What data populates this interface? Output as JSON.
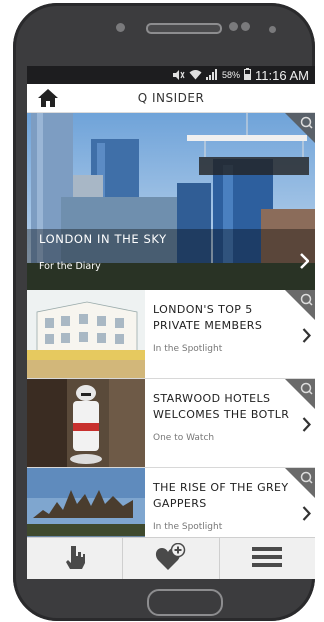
{
  "status_bar": {
    "battery": "58%",
    "time": "11:16 AM"
  },
  "header": {
    "title": "Q INSIDER"
  },
  "hero": {
    "title": "LONDON IN THE SKY",
    "category": "For the Diary"
  },
  "articles": [
    {
      "title_line1": "LONDON'S TOP 5",
      "title_line2": "PRIVATE MEMBERS",
      "category": "In the Spotlight"
    },
    {
      "title_line1": "STARWOOD HOTELS",
      "title_line2": "WELCOMES THE BOTLR",
      "category": "One to Watch"
    },
    {
      "title_line1": "THE RISE OF THE GREY",
      "title_line2": "GAPPERS",
      "category": "In the Spotlight"
    }
  ],
  "colors": {
    "bezel": "#3c3c3e",
    "status_bar": "#1d1d1f",
    "accent_icons": "#4a4a4a"
  },
  "icons": {
    "home": "home-icon",
    "status": [
      "mute-icon",
      "wifi-icon",
      "signal-icon",
      "battery-icon"
    ],
    "tabs": [
      "hand-icon",
      "heart-plus-icon",
      "menu-icon"
    ],
    "badge": "search-icon"
  }
}
